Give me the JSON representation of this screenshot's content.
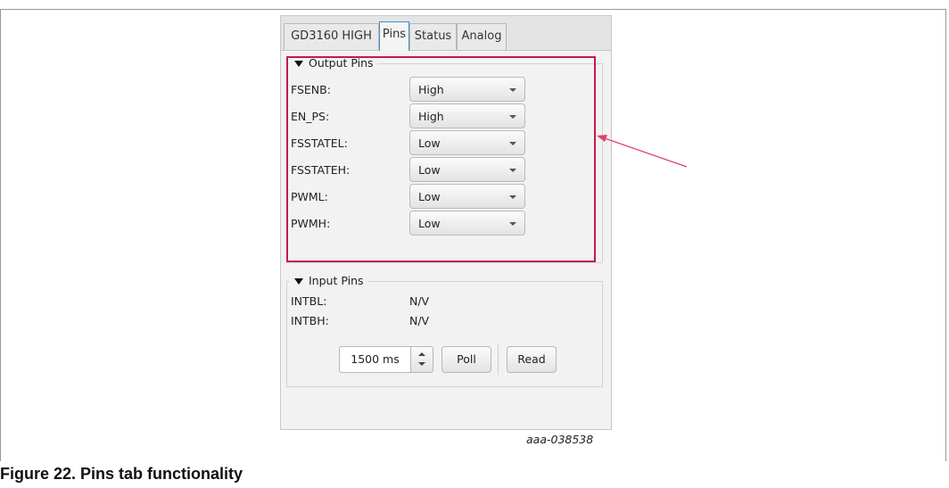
{
  "tabs": [
    {
      "label": "GD3160 HIGH",
      "active": false
    },
    {
      "label": "Pins",
      "active": true
    },
    {
      "label": "Status",
      "active": false
    },
    {
      "label": "Analog",
      "active": false
    }
  ],
  "output_pins": {
    "title": "Output Pins",
    "rows": [
      {
        "label": "FSENB:",
        "value": "High"
      },
      {
        "label": "EN_PS:",
        "value": "High"
      },
      {
        "label": "FSSTATEL:",
        "value": "Low"
      },
      {
        "label": "FSSTATEH:",
        "value": "Low"
      },
      {
        "label": "PWML:",
        "value": "Low"
      },
      {
        "label": "PWMH:",
        "value": "Low"
      }
    ]
  },
  "input_pins": {
    "title": "Input Pins",
    "rows": [
      {
        "label": "INTBL:",
        "value": "N/V"
      },
      {
        "label": "INTBH:",
        "value": "N/V"
      }
    ],
    "poll_interval": "1500 ms",
    "poll_label": "Poll",
    "read_label": "Read"
  },
  "annotation": {
    "highlight_color": "#c8174f",
    "arrow_color": "#e0436a"
  },
  "figure": {
    "doc_id": "aaa-038538",
    "caption": "Figure 22.  Pins tab functionality"
  }
}
